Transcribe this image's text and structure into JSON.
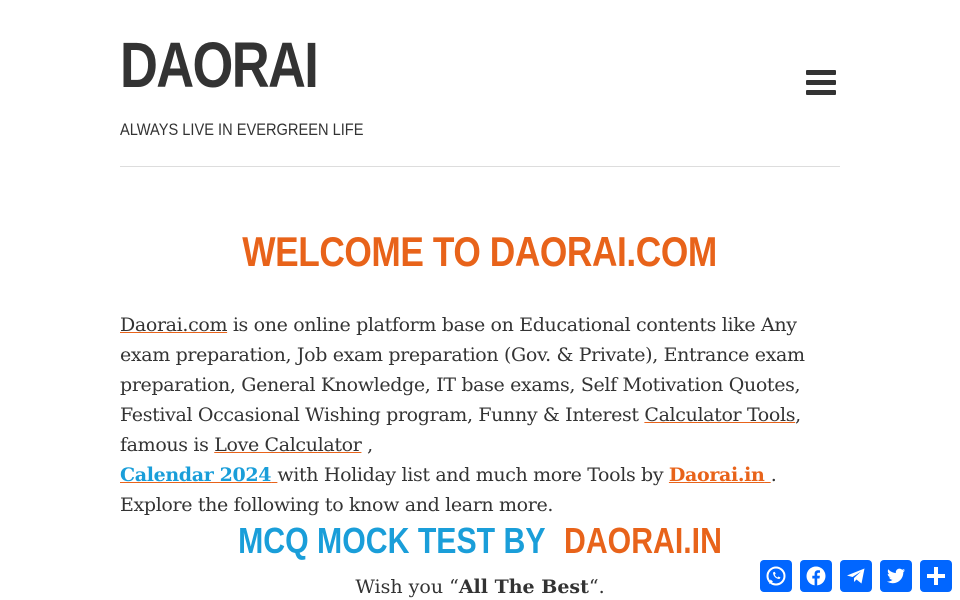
{
  "header": {
    "site_title": "DAORAI",
    "tagline": "ALWAYS LIVE IN EVERGREEN LIFE",
    "menu_icon": "hamburger-icon"
  },
  "main": {
    "welcome_heading": "WELCOME TO DAORAI.COM",
    "intro": {
      "link_daorai_com": "Daorai.com",
      "text1": " is one online platform base on Educational contents like Any exam preparation, Job exam preparation (Gov. & Private), Entrance exam preparation, General Knowledge, IT base exams, Self Motivation Quotes, Festival Occasional Wishing program, Funny & Interest ",
      "link_calculator_tools": "Calculator Tools",
      "text2": ", famous is  ",
      "link_love_calculator": "Love Calculator",
      "text3": " ,",
      "link_calendar": "Calendar 2024",
      "text4": "  with Holiday list and much more Tools by ",
      "link_daorai_in": "Daorai.in",
      "text5": ". Explore the following to know and learn more."
    },
    "mcq_heading_part1": "MCQ MOCK TEST BY",
    "mcq_heading_part2": "DAORAI.IN",
    "wish": {
      "prefix": "Wish you “",
      "bold": "All The Best",
      "suffix": "“."
    }
  },
  "share_bar": {
    "buttons": [
      {
        "name": "WhatsApp",
        "icon": "whatsapp-icon"
      },
      {
        "name": "Facebook",
        "icon": "facebook-icon"
      },
      {
        "name": "Telegram",
        "icon": "telegram-icon"
      },
      {
        "name": "Twitter",
        "icon": "twitter-icon"
      },
      {
        "name": "Share",
        "icon": "share-icon"
      }
    ]
  },
  "colors": {
    "accent_orange": "#e8631a",
    "accent_blue": "#1a9ed9",
    "share_blue": "#0166ff",
    "text": "#333333"
  }
}
